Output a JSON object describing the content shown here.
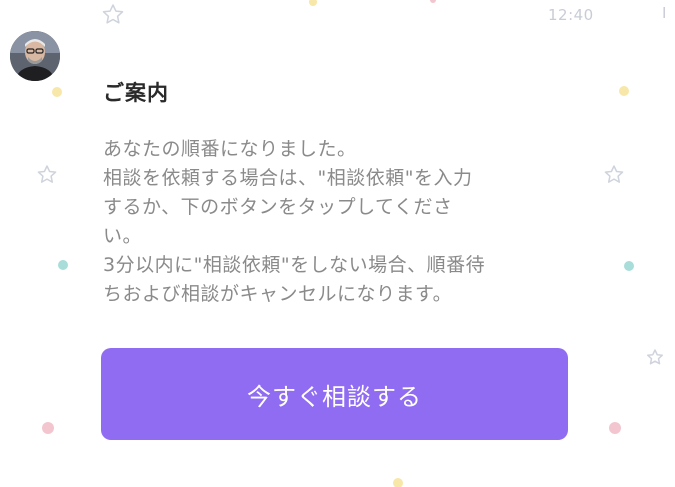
{
  "status": {
    "time": "12:40",
    "time_tail": "J"
  },
  "message": {
    "title": "ご案内",
    "body_lines": [
      "あなたの順番になりました。",
      "相談を依頼する場合は、\"相談依頼\"を入力",
      "するか、下のボタンをタップしてくださ",
      "い。",
      "3分以内に\"相談依頼\"をしない場合、順番待",
      "ちおよび相談がキャンセルになります。"
    ],
    "button_label": "今すぐ相談する"
  },
  "colors": {
    "button": "#8f6cf1",
    "button_text": "#ffffff",
    "title": "#2a2a2a",
    "body_text": "#8a8a8a",
    "decor_pink": "#f3c6cf",
    "decor_yellow": "#f7e7a8",
    "decor_teal": "#a9ddd9",
    "decor_star": "#cfd3dc"
  },
  "icons": {
    "avatar": "advisor-avatar",
    "background_stars": "star-outline-icon",
    "background_dots": "confetti-dot-icon"
  }
}
